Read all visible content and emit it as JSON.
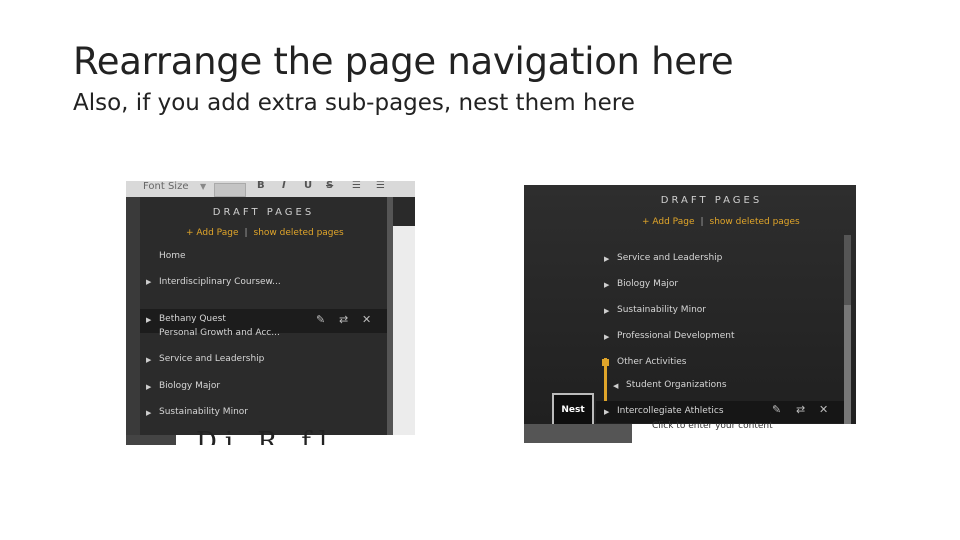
{
  "slide": {
    "title": "Rearrange the page navigation here",
    "subtitle": "Also, if you add extra sub-pages, nest them here"
  },
  "left_screenshot": {
    "toolbar": {
      "font_size_label": "Font Size",
      "bold": "B",
      "italic": "I",
      "underline": "U"
    },
    "panel_title": "DRAFT PAGES",
    "add_page": "+ Add Page",
    "separator": "|",
    "show_deleted": "show deleted pages",
    "items": [
      {
        "label": "Home",
        "has_children": false
      },
      {
        "label": "Interdisciplinary Coursew...",
        "has_children": true
      },
      {
        "label": "Bethany Quest",
        "has_children": true,
        "dragging": true
      },
      {
        "label": "Personal Growth and Acc...",
        "has_children": false
      },
      {
        "label": "Service and Leadership",
        "has_children": true
      },
      {
        "label": "Biology Major",
        "has_children": true
      },
      {
        "label": "Sustainability Minor",
        "has_children": true
      }
    ],
    "bottom_text": "Di    R fl"
  },
  "right_screenshot": {
    "panel_title": "DRAFT PAGES",
    "add_page": "+ Add Page",
    "separator": "|",
    "show_deleted": "show deleted pages",
    "items": [
      {
        "label": "Service and Leadership"
      },
      {
        "label": "Biology Major"
      },
      {
        "label": "Sustainability Minor"
      },
      {
        "label": "Professional Development"
      },
      {
        "label": "Other Activities"
      },
      {
        "label": "Student Organizations"
      },
      {
        "label": "Intercollegiate Athletics",
        "dragging": true
      }
    ],
    "nest_label": "Nest",
    "bottom_text": "Click to enter your content"
  },
  "colors": {
    "accent": "#e0a52a",
    "panel": "#2b2b2b",
    "text": "#d6d6d6"
  }
}
